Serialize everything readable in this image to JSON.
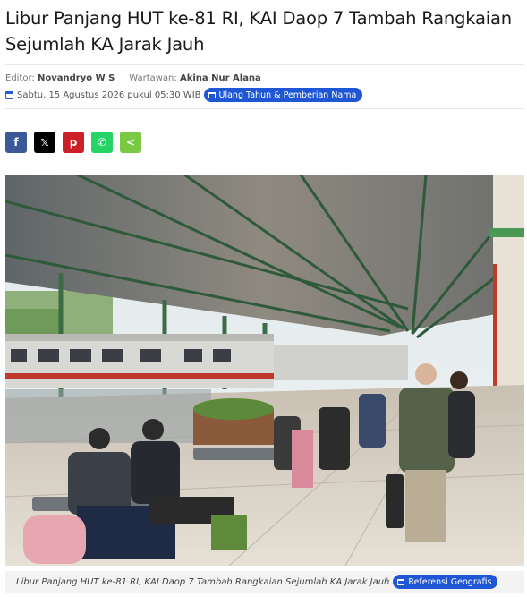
{
  "article": {
    "title": "Libur Panjang HUT ke-81 RI, KAI Daop 7 Tambah Rangkaian Sejumlah KA Jarak Jauh",
    "editor_label": "Editor:",
    "editor_name": "Novandryo W S",
    "reporter_label": "Wartawan:",
    "reporter_name": "Akina Nur Alana",
    "date": "Sabtu, 15 Agustus 2026 pukul 05:30 WIB",
    "category_badge": "Ulang Tahun & Pemberian Nama",
    "caption": "Libur Panjang HUT ke-81 RI, KAI Daop 7 Tambah Rangkaian Sejumlah KA Jarak Jauh",
    "caption_badge": "Referensi Geografis"
  },
  "share": [
    {
      "name": "facebook-icon",
      "glyph": "f",
      "color": "#3b5998"
    },
    {
      "name": "x-icon",
      "glyph": "𝕏",
      "color": "#000000"
    },
    {
      "name": "pinterest-icon",
      "glyph": "p",
      "color": "#cb2027"
    },
    {
      "name": "whatsapp-icon",
      "glyph": "✆",
      "color": "#25d366"
    },
    {
      "name": "share-icon",
      "glyph": "<",
      "color": "#7ac943"
    }
  ],
  "colors": {
    "accent": "#1f56d6"
  }
}
